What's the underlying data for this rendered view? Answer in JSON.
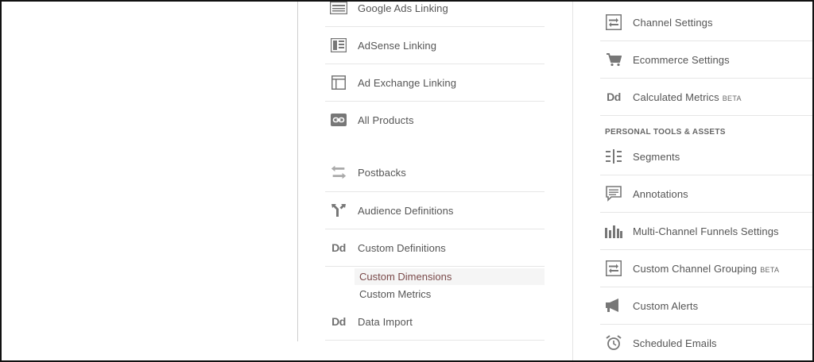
{
  "middle_column": {
    "items": [
      {
        "label": "Google Ads Linking",
        "icon": "google-ads-icon"
      },
      {
        "label": "AdSense Linking",
        "icon": "adsense-icon"
      },
      {
        "label": "Ad Exchange Linking",
        "icon": "ad-exchange-icon"
      },
      {
        "label": "All Products",
        "icon": "link-icon"
      },
      {
        "label": "Postbacks",
        "icon": "postbacks-icon"
      },
      {
        "label": "Audience Definitions",
        "icon": "audience-fork-icon"
      },
      {
        "label": "Custom Definitions",
        "icon": "dd-icon",
        "icon_text": "Dd"
      },
      {
        "label": "Data Import",
        "icon": "dd-icon",
        "icon_text": "Dd"
      }
    ],
    "custom_definitions_subitems": [
      {
        "label": "Custom Dimensions",
        "active": true
      },
      {
        "label": "Custom Metrics",
        "active": false
      }
    ]
  },
  "right_column": {
    "items": [
      {
        "label": "Channel Settings",
        "icon": "channel-settings-icon"
      },
      {
        "label": "Ecommerce Settings",
        "icon": "cart-icon"
      },
      {
        "label": "Calculated Metrics",
        "badge": "BETA",
        "icon": "dd-icon",
        "icon_text": "Dd"
      }
    ],
    "section_header": "PERSONAL TOOLS & ASSETS",
    "personal_items": [
      {
        "label": "Segments",
        "icon": "segments-icon"
      },
      {
        "label": "Annotations",
        "icon": "annotations-icon"
      },
      {
        "label": "Multi-Channel Funnels Settings",
        "icon": "bar-chart-icon"
      },
      {
        "label": "Custom Channel Grouping",
        "badge": "BETA",
        "icon": "channel-grouping-icon"
      },
      {
        "label": "Custom Alerts",
        "icon": "megaphone-icon"
      },
      {
        "label": "Scheduled Emails",
        "icon": "alarm-clock-icon"
      }
    ]
  }
}
